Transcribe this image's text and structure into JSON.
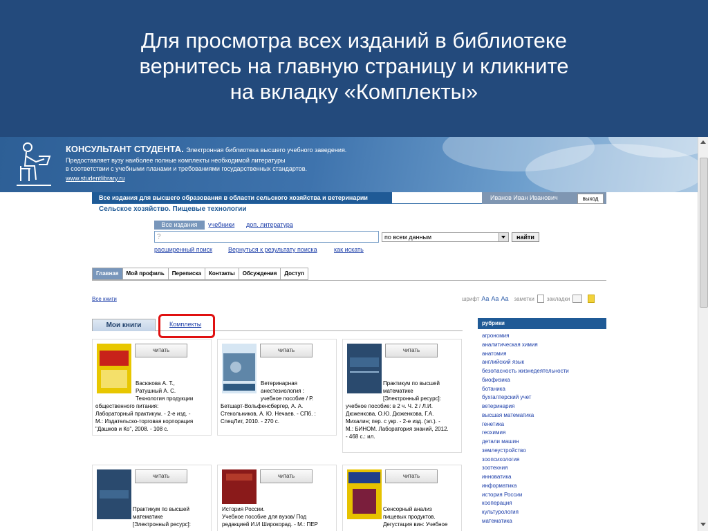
{
  "slide": {
    "heading_lines": [
      "Для просмотра всех изданий в библиотеке",
      "вернитесь на главную страницу и кликните",
      "на вкладку «Комплекты»"
    ]
  },
  "colors": {
    "slide_header": "#234a7c",
    "primary_bar": "#1f5a96",
    "link": "#1a3ca8",
    "highlight_box": "#e01010"
  },
  "site": {
    "brand_name": "КОНСУЛЬТАНТ СТУДЕНТА.",
    "brand_tagline": "Электронная библиотека высшего учебного заведения.",
    "description_lines": [
      "Предоставляет вузу наиболее полные комплекты необходимой литературы",
      "в соответствии с учебными планами и требованиями государственных стандартов."
    ],
    "url": "www.studentlibrary.ru"
  },
  "header": {
    "section_title": "Все издания для высшего образования в области сельского хозяйства и ветеринарии",
    "subtitle": "Сельское хозяйство. Пищевые технологии",
    "user_name": "Иванов Иван Иванович",
    "logout_label": "выход"
  },
  "search": {
    "tabs": [
      "Все издания",
      "учебники",
      "доп. литература"
    ],
    "placeholder": "?",
    "scope_selected": "по всем данным",
    "find_label": "найти",
    "links": [
      "расширенный поиск",
      "Вернуться к результату поиска",
      "как искать"
    ]
  },
  "nav": {
    "tabs": [
      "Главная",
      "Мой профиль",
      "Переписка",
      "Контакты",
      "Обсуждения",
      "Доступ"
    ]
  },
  "toolbar": {
    "breadcrumb": "Все книги",
    "font_label": "шрифт",
    "font_sizes": [
      "Aa",
      "Aa",
      "Aa"
    ],
    "notes_label": "заметки",
    "bookmarks_label": "закладки"
  },
  "book_tabs": {
    "my_books": "Мои книги",
    "kits": "Комплекты"
  },
  "books": [
    {
      "read": "читать",
      "cover_title": "Технология продукции общественного питания",
      "author_line": "Васюкова А. Т.,\nРатушный А. С.\nТехнология продукции",
      "text": "общественного питания:\nЛабораторный практикум. - 2-е изд. -\nМ.: Издательско-торговая корпорация\n\"Дашков и Ко\", 2008. - 108 с."
    },
    {
      "read": "читать",
      "cover_title": "Ветеринарная анестезиология",
      "author_line": "Ветеринарная\nанестезиология :\nучебное пособие / Р.",
      "text": "Бетшарт-Вольфенсбергер, А. А.\nСтекольников, А. Ю. Нечаев. - СПб. :\nСпецЛит, 2010. - 270 с."
    },
    {
      "read": "читать",
      "cover_title": "Практикум по высшей математике",
      "author_line": "Практикум по высшей\nматематике\n[Электронный ресурс]:",
      "text": "учебное пособие: в 2 ч. Ч. 2 / Л.И.\nДюженкова, О.Ю. Дюженкова, Г.А.\nМихалин; пер. с укр. - 2-е изд. (эл.). -\nМ.: БИНОМ. Лаборатория знаний, 2012.\n- 468 с.: ил."
    },
    {
      "read": "читать",
      "cover_title": "Практикум",
      "author_line": "Практикум по высшей\nматематике\n[Электронный ресурс]:",
      "text": ""
    },
    {
      "read": "читать",
      "cover_title": "История России",
      "author_line": "История России.\nУчебное пособие для вузов/ Под\nредакцией И.И Широкорад. - М.: ПЕР",
      "text": ""
    },
    {
      "read": "читать",
      "cover_title": "Сенсорный анализ пищевых продуктов",
      "author_line": "Сенсорный анализ\nпищевых продуктов.\nДегустация вин: Учебное",
      "text": ""
    }
  ],
  "rubrics": {
    "title": "рубрики",
    "items": [
      "агрономия",
      "аналитическая химия",
      "анатомия",
      "английский язык",
      "безопасность жизнедеятельности",
      "биофизика",
      "ботаника",
      "бухгалтерский учет",
      "ветеринария",
      "высшая математика",
      "генетика",
      "геохимия",
      "детали машин",
      "землеустройство",
      "зоопсихология",
      "зоотехния",
      "инноватика",
      "информатика",
      "история России",
      "кооперация",
      "культурология",
      "математика"
    ]
  }
}
